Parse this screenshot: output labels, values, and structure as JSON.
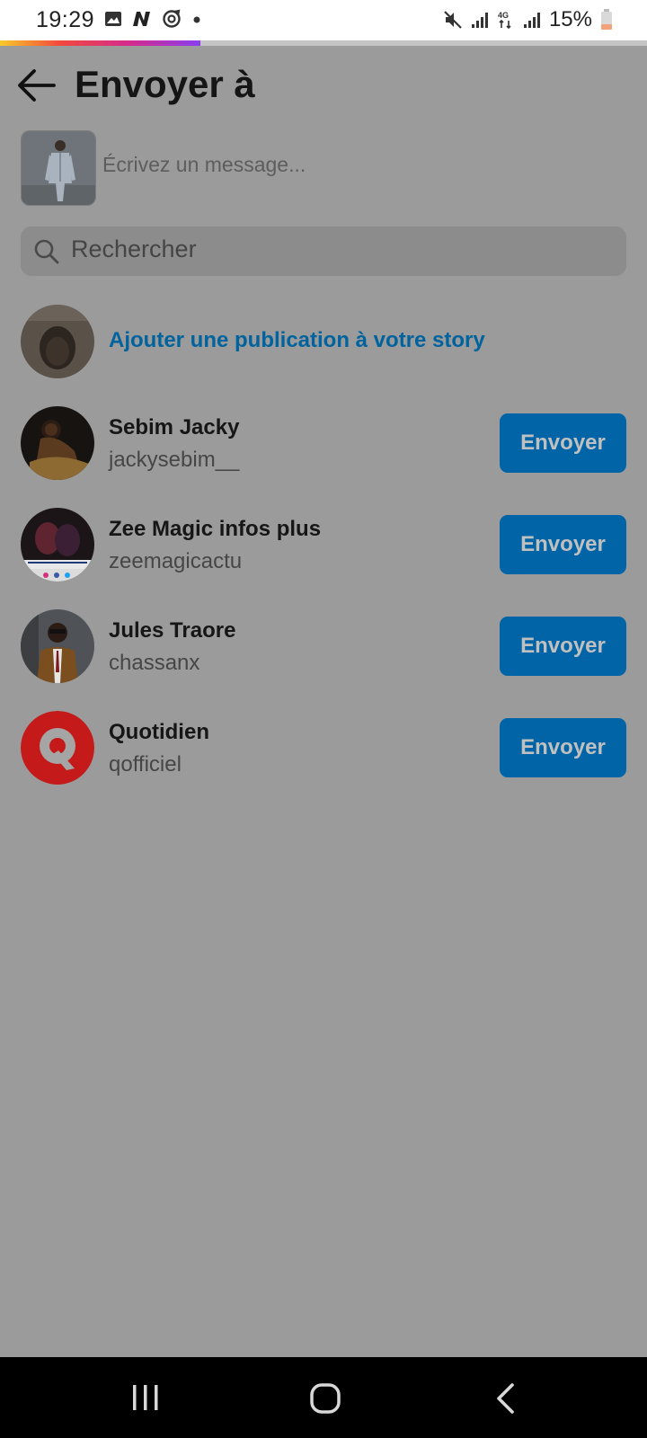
{
  "status_bar": {
    "time": "19:29",
    "battery_text": "15%",
    "left_icons": [
      "image-icon",
      "n-app-icon",
      "sync-icon",
      "dot-icon"
    ],
    "right_icons": [
      "mute-icon",
      "signal-icon",
      "4g-icon",
      "signal-icon",
      "battery-icon"
    ]
  },
  "upload_progress": 0.31,
  "header": {
    "back_icon": "arrow-left-icon",
    "title": "Envoyer à"
  },
  "compose": {
    "placeholder": "Écrivez un message..."
  },
  "search": {
    "placeholder": "Rechercher",
    "icon": "search-icon"
  },
  "story": {
    "label": "Ajouter une publication à votre story"
  },
  "recipients": [
    {
      "name": "Sebim Jacky",
      "handle": "jackysebim__",
      "button": "Envoyer"
    },
    {
      "name": "Zee Magic infos plus",
      "handle": "zeemagicactu",
      "button": "Envoyer"
    },
    {
      "name": "Jules Traore",
      "handle": "chassanx",
      "button": "Envoyer"
    },
    {
      "name": "Quotidien",
      "handle": "qofficiel",
      "button": "Envoyer"
    }
  ],
  "nav_bar": {
    "items": [
      "recent-apps-icon",
      "home-icon",
      "back-icon"
    ]
  },
  "colors": {
    "overlay": "#9b9b9b",
    "accent": "#0064a6",
    "story_link": "#00639e",
    "quotidien_brand": "#c41a1a"
  }
}
